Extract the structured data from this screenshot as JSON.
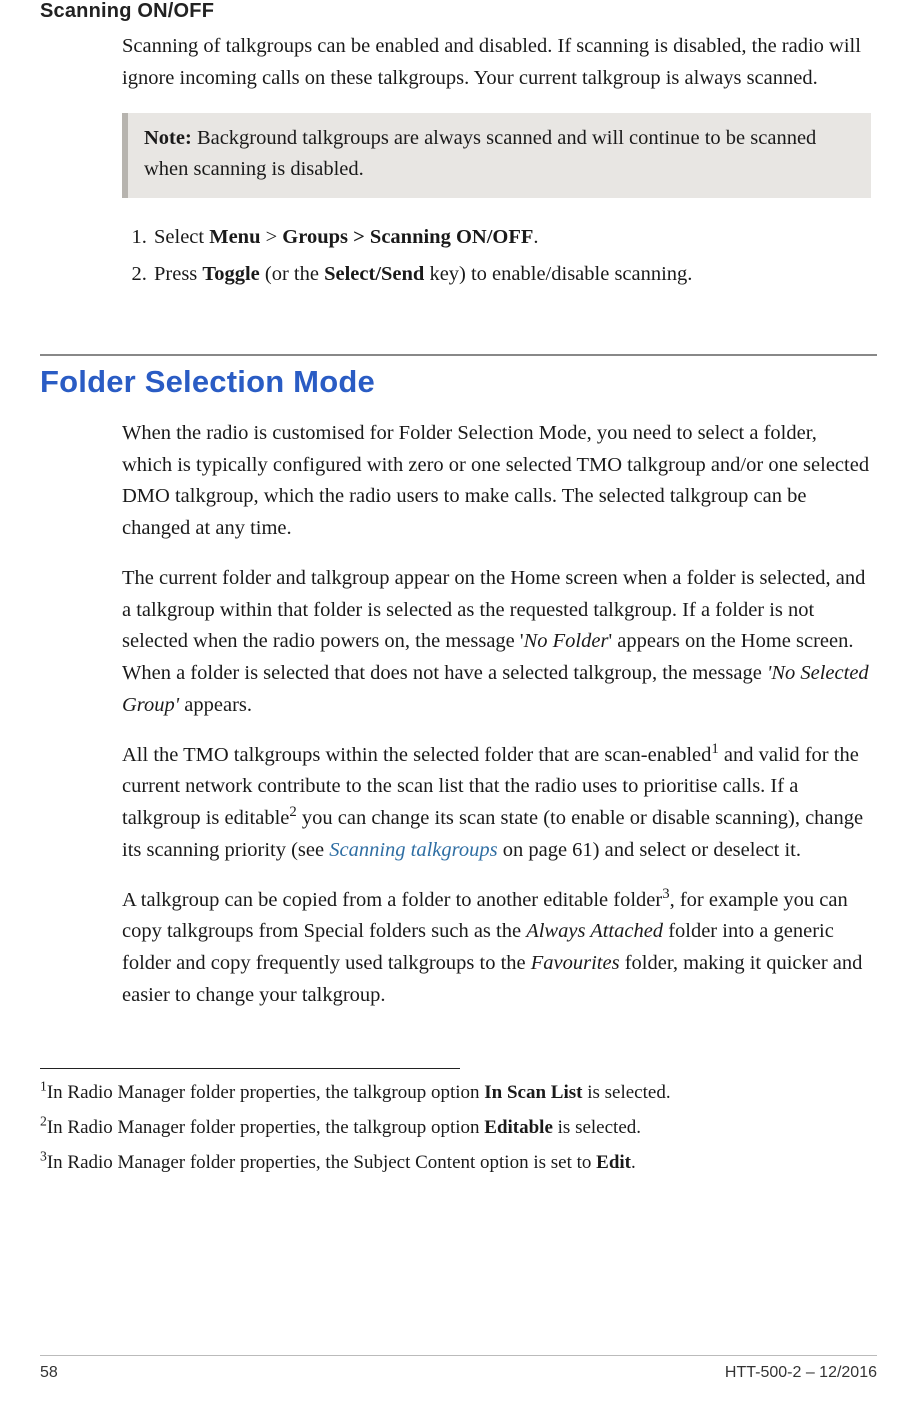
{
  "section1": {
    "heading": "Scanning ON/OFF",
    "para1": "Scanning of talkgroups can be enabled and disabled. If scanning is disabled, the radio will ignore incoming calls on these talkgroups. Your current talkgroup is always scanned.",
    "note_label": "Note:",
    "note_body": "  Background talkgroups are always scanned and will continue to be scanned when scanning is disabled.",
    "step1_a": "Select ",
    "step1_b": "Menu",
    "step1_c": " > ",
    "step1_d": "Groups > Scanning ON/OFF",
    "step1_e": ".",
    "step2_a": "Press ",
    "step2_b": "Toggle",
    "step2_c": " (or the ",
    "step2_d": "Select/Send",
    "step2_e": " key) to enable/disable scanning."
  },
  "section2": {
    "heading": "Folder Selection Mode",
    "p1": "When the radio is customised for Folder Selection Mode, you need to select a folder, which is typically configured with zero or one selected TMO talkgroup and/or one selected DMO talkgroup, which the radio users to make calls. The selected talkgroup can be changed at any time.",
    "p2_a": "The current folder and talkgroup appear on the Home screen when a folder is selected, and a talkgroup within that folder is selected as the requested talkgroup. If a folder is not selected when the radio powers on, the message '",
    "p2_b": "No Folder",
    "p2_c": "' appears on the Home screen. When a folder is selected that does not have a selected talkgroup, the message ",
    "p2_d": "'No Selected Group'",
    "p2_e": " appears.",
    "p3_a": "All the TMO talkgroups within the selected folder that are scan-enabled",
    "p3_sup1": "1",
    "p3_b": " and valid for the current network contribute to the scan list that the radio uses to prioritise calls. If a talkgroup is editable",
    "p3_sup2": "2",
    "p3_c": " you can change its scan state (to enable or disable scanning), change its scanning priority (see ",
    "p3_link": "Scanning talkgroups",
    "p3_d": "  on page 61) and select or deselect it.",
    "p4_a": "A talkgroup can be copied from a folder to another editable folder",
    "p4_sup3": "3",
    "p4_b": ", for example you can copy talkgroups from Special folders such as the ",
    "p4_c": "Always Attached",
    "p4_d": " folder into a generic folder and copy frequently used talkgroups to the ",
    "p4_e": "Favourites",
    "p4_f": " folder, making it quicker and easier to change your talkgroup."
  },
  "footnotes": {
    "f1_sup": "1",
    "f1_a": "In Radio Manager folder properties, the talkgroup option ",
    "f1_b": "In Scan List",
    "f1_c": " is selected.",
    "f2_sup": "2",
    "f2_a": "In Radio Manager folder properties, the talkgroup option ",
    "f2_b": "Editable",
    "f2_c": " is selected.",
    "f3_sup": "3",
    "f3_a": "In Radio Manager folder properties, the Subject Content option is set to ",
    "f3_b": "Edit",
    "f3_c": "."
  },
  "footer": {
    "page": "58",
    "docid": "HTT-500-2 – 12/2016"
  }
}
